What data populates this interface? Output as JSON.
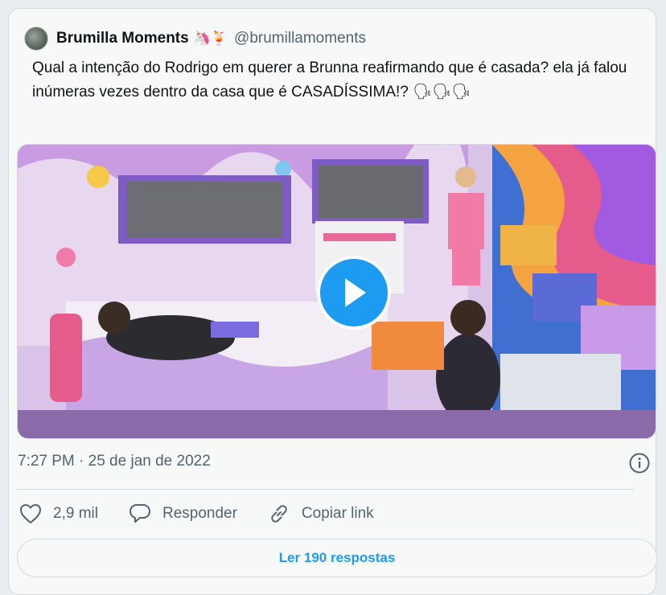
{
  "tweet": {
    "author_name": "Brumilla Moments",
    "author_emojis": "🦄🍹",
    "handle": "@brumillamoments",
    "text": "Qual a intenção do Rodrigo em querer a Brunna reafirmando que é casada? ela já falou inúmeras vezes dentro da casa que é CASADÍSSIMA!? 🗣🗣🗣",
    "timestamp": "7:27 PM · 25 de jan de 2022",
    "likes": "2,9 mil",
    "reply_label": "Responder",
    "copy_link_label": "Copiar link",
    "read_replies_label": "Ler 190 respostas"
  },
  "icons": {
    "play": "play-icon",
    "info": "info-icon",
    "like": "heart-icon",
    "reply": "speech-bubble-icon",
    "link": "link-icon"
  },
  "colors": {
    "accent": "#1d9bf0",
    "text_primary": "#0f1419",
    "text_secondary": "#536471",
    "border": "#cfd9de"
  }
}
